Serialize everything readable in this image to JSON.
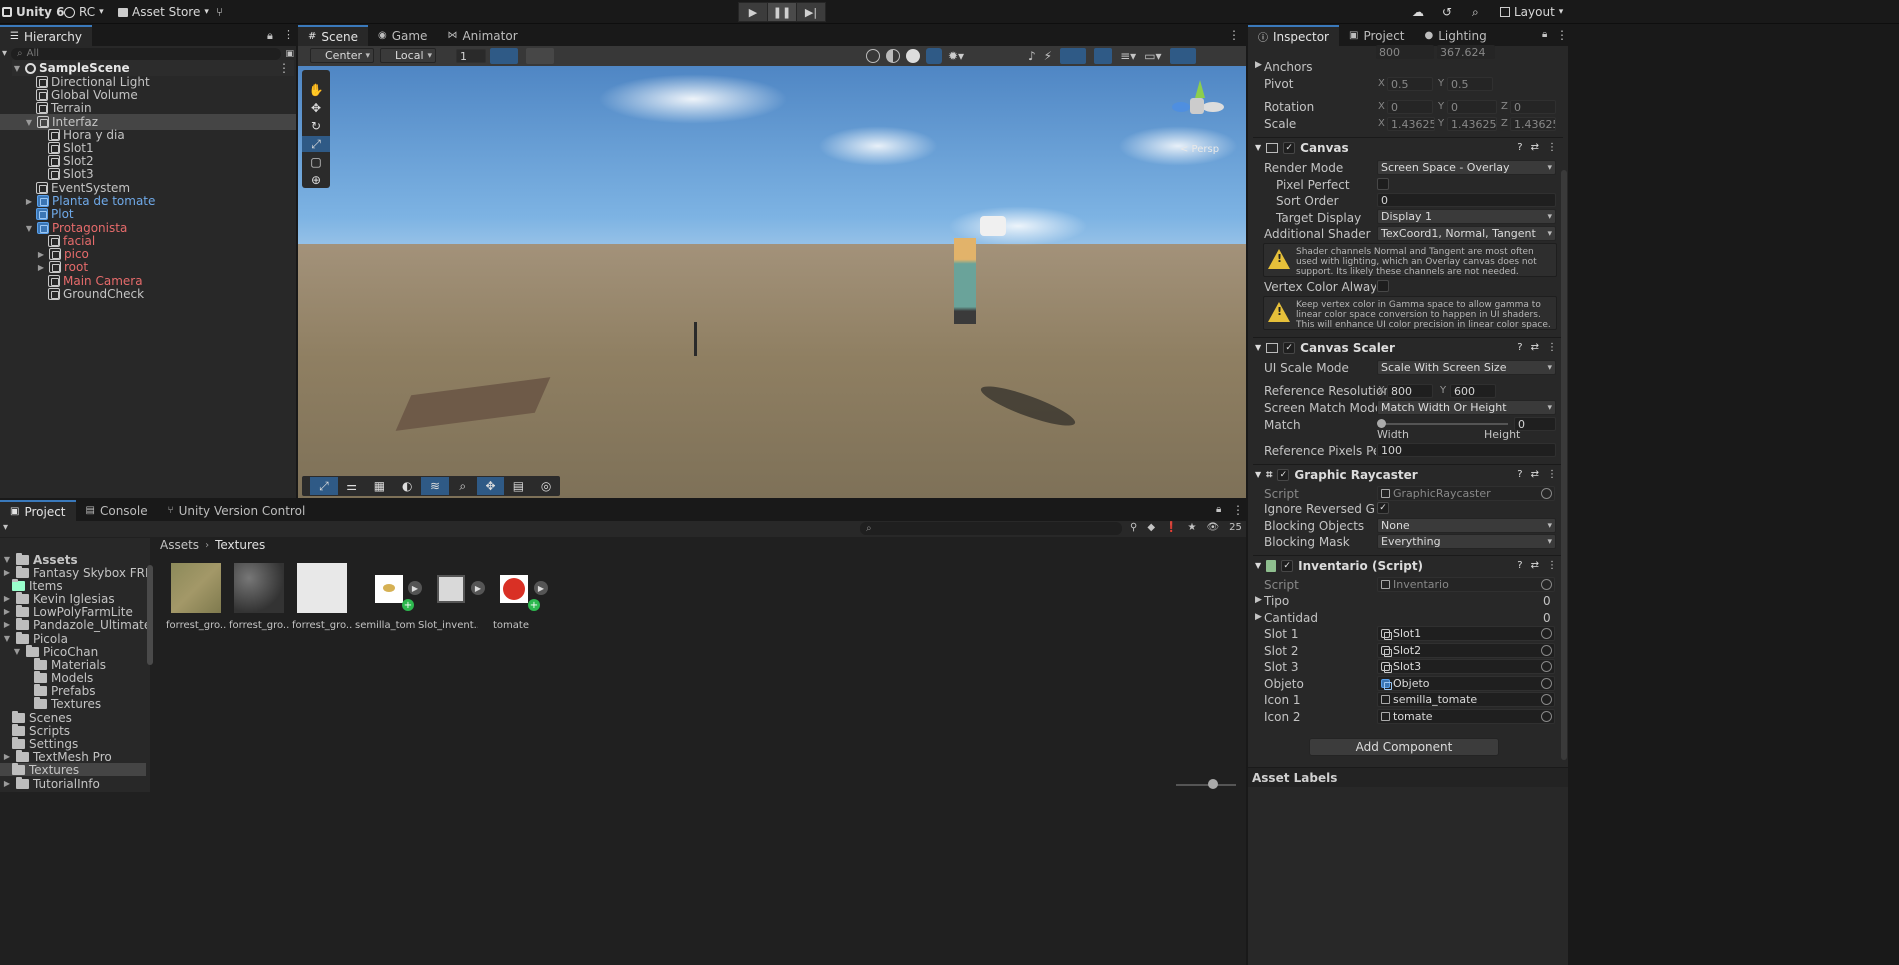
{
  "toolbar": {
    "app": "Unity 6",
    "account": "RC",
    "asset_store": "Asset Store",
    "layout": "Layout"
  },
  "hierarchy": {
    "tab": "Hierarchy",
    "search_placeholder": "All",
    "items": [
      {
        "label": "SampleScene",
        "color": "#e6e6e6"
      },
      {
        "label": "Directional Light",
        "color": "#c4c4c4"
      },
      {
        "label": "Global Volume",
        "color": "#c4c4c4"
      },
      {
        "label": "Terrain",
        "color": "#c4c4c4"
      },
      {
        "label": "Interfaz",
        "color": "#c4c4c4"
      },
      {
        "label": "Hora y dia",
        "color": "#c4c4c4"
      },
      {
        "label": "Slot1",
        "color": "#c4c4c4"
      },
      {
        "label": "Slot2",
        "color": "#c4c4c4"
      },
      {
        "label": "Slot3",
        "color": "#c4c4c4"
      },
      {
        "label": "EventSystem",
        "color": "#c4c4c4"
      },
      {
        "label": "Planta de tomate",
        "color": "#6fa9e8"
      },
      {
        "label": "Plot",
        "color": "#6fa9e8"
      },
      {
        "label": "Protagonista",
        "color": "#e66b6b"
      },
      {
        "label": "facial",
        "color": "#e66b6b"
      },
      {
        "label": "pico",
        "color": "#e66b6b"
      },
      {
        "label": "root",
        "color": "#e66b6b"
      },
      {
        "label": "Main Camera",
        "color": "#e66b6b"
      },
      {
        "label": "GroundCheck",
        "color": "#c4c4c4"
      }
    ]
  },
  "scene": {
    "tabs": [
      "Scene",
      "Game",
      "Animator"
    ],
    "pivot": "Center",
    "space": "Local",
    "grid_value": "1",
    "persp_label": "< Persp"
  },
  "project": {
    "tabs": [
      "Project",
      "Console",
      "Unity Version Control"
    ],
    "count": "25",
    "breadcrumb": [
      "Assets",
      "Textures"
    ],
    "tree": [
      {
        "label": "Assets",
        "bold": true
      },
      {
        "label": "Fantasy Skybox FREE"
      },
      {
        "label": "Items"
      },
      {
        "label": "Kevin Iglesias"
      },
      {
        "label": "LowPolyFarmLite"
      },
      {
        "label": "Pandazole_Ultimate_Pack"
      },
      {
        "label": "Picola"
      },
      {
        "label": "PicoChan"
      },
      {
        "label": "Materials"
      },
      {
        "label": "Models"
      },
      {
        "label": "Prefabs"
      },
      {
        "label": "Textures"
      },
      {
        "label": "Scenes"
      },
      {
        "label": "Scripts"
      },
      {
        "label": "Settings"
      },
      {
        "label": "TextMesh Pro"
      },
      {
        "label": "Textures"
      },
      {
        "label": "TutorialInfo"
      }
    ],
    "assets": [
      "forrest_gro...",
      "forrest_gro...",
      "forrest_gro...",
      "semilla_tom...",
      "Slot_invent...",
      "tomate"
    ]
  },
  "inspector": {
    "tabs": [
      "Inspector",
      "Project",
      "Lighting"
    ],
    "top_values": [
      "800",
      "367.624"
    ],
    "anchors": "Anchors",
    "pivot": {
      "label": "Pivot",
      "x": "0.5",
      "y": "0.5"
    },
    "rotation": {
      "label": "Rotation",
      "x": "0",
      "y": "0",
      "z": "0"
    },
    "scale": {
      "label": "Scale",
      "x": "1.43625",
      "y": "1.43625",
      "z": "1.43625"
    },
    "canvas": {
      "title": "Canvas",
      "render_mode_label": "Render Mode",
      "render_mode": "Screen Space - Overlay",
      "pixel_perfect": "Pixel Perfect",
      "sort_order_label": "Sort Order",
      "sort_order": "0",
      "target_display_label": "Target Display",
      "target_display": "Display 1",
      "shader_label": "Additional Shader Chan",
      "shader_value": "TexCoord1, Normal, Tangent",
      "warn1": "Shader channels Normal and Tangent are most often used with lighting, which an Overlay canvas does not support. Its likely these channels are not needed.",
      "vertex_label": "Vertex Color Always In (",
      "warn2": "Keep vertex color in Gamma space to allow gamma to linear color space conversion to happen in UI shaders. This will enhance UI color precision in linear color space."
    },
    "scaler": {
      "title": "Canvas Scaler",
      "mode_label": "UI Scale Mode",
      "mode": "Scale With Screen Size",
      "ref_label": "Reference Resolution",
      "ref_x": "800",
      "ref_y": "600",
      "match_mode_label": "Screen Match Mode",
      "match_mode": "Match Width Or Height",
      "match_label": "Match",
      "match_value": "0",
      "width": "Width",
      "height": "Height",
      "ppu_label": "Reference Pixels Per Un",
      "ppu": "100"
    },
    "raycaster": {
      "title": "Graphic Raycaster",
      "script_label": "Script",
      "script": "GraphicRaycaster",
      "ignore_label": "Ignore Reversed Gra...",
      "blocking_objects_label": "Blocking Objects",
      "blocking_objects": "None",
      "blocking_mask_label": "Blocking Mask",
      "blocking_mask": "Everything"
    },
    "inventario": {
      "title": "Inventario (Script)",
      "script_label": "Script",
      "script": "Inventario",
      "tipo_label": "Tipo",
      "tipo": "0",
      "cantidad_label": "Cantidad",
      "cantidad": "0",
      "fields": [
        {
          "label": "Slot 1",
          "value": "Slot1"
        },
        {
          "label": "Slot 2",
          "value": "Slot2"
        },
        {
          "label": "Slot 3",
          "value": "Slot3"
        },
        {
          "label": "Objeto",
          "value": "Objeto"
        },
        {
          "label": "Icon 1",
          "value": "semilla_tomate"
        },
        {
          "label": "Icon 2",
          "value": "tomate"
        }
      ]
    },
    "add_component": "Add Component",
    "asset_labels": "Asset Labels"
  }
}
